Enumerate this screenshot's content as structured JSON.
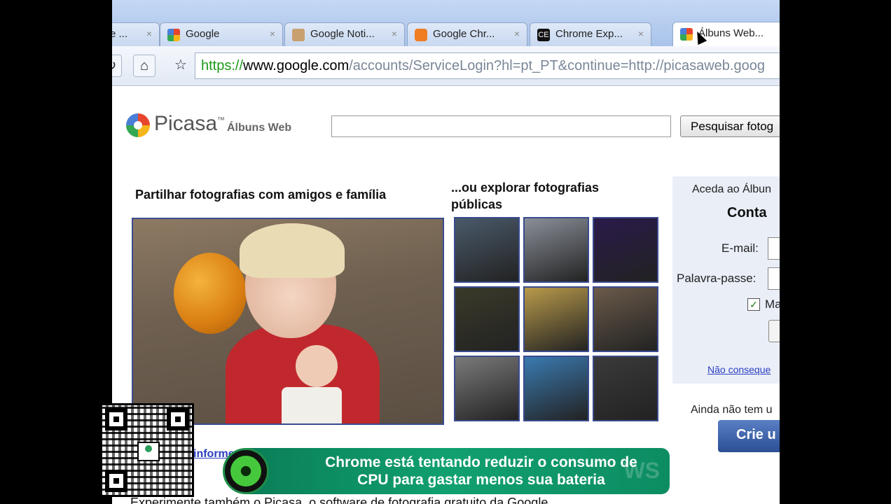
{
  "browser": {
    "tabs": [
      {
        "label": "e ...",
        "favicon": "page-icon",
        "color": "#cfd9e8"
      },
      {
        "label": "Google",
        "favicon": "google-icon",
        "color": "#4a7fd8"
      },
      {
        "label": "Google Noti...",
        "favicon": "google-news-icon",
        "color": "#c8a070"
      },
      {
        "label": "Google Chr...",
        "favicon": "blogger-icon",
        "color": "#f07d22"
      },
      {
        "label": "Chrome Exp...",
        "favicon": "ce-icon",
        "color": "#111111"
      },
      {
        "label": "Álbuns Web...",
        "favicon": "google-icon",
        "color": "#4a7fd8",
        "active": true
      }
    ],
    "close_glyph": "×",
    "url": {
      "scheme": "https://",
      "host": "www.google.com",
      "path": "/accounts/ServiceLogin?hl=pt_PT&continue=http://picasaweb.goog"
    }
  },
  "header": {
    "logo": "Picasa",
    "logo_tm": "™",
    "logo_sub": "Álbuns Web",
    "search_value": "",
    "search_button": "Pesquisar fotog"
  },
  "main": {
    "share_heading": "Partilhar fotografias com amigos e família",
    "explore_heading": "...ou explorar fotografias públicas",
    "thumbnail_colors": [
      "#4a5a6a",
      "#8a8f98",
      "#2a1a4a",
      "#3a3a2a",
      "#b89a4a",
      "#6a5a4a",
      "#7a7a7a",
      "#3a7ab0",
      "#3a3a3a"
    ],
    "info_link": "informe",
    "footer": "Experimente também o Picasa, o software de fotografia gratuito da Google"
  },
  "login": {
    "prompt": "Aceda ao Álbun",
    "account": "Conta",
    "email_label": "E-mail:",
    "password_label": "Palavra-passe:",
    "remember_label": "Ma",
    "remember_checked": true,
    "cant_access": "Não conseque",
    "no_account": "Ainda não tem u",
    "create_button": "Crie u"
  },
  "overlay": {
    "banner": "Chrome está tentando reduzir o consumo de CPU para gastar menos sua bateria",
    "watermark": "WS"
  }
}
